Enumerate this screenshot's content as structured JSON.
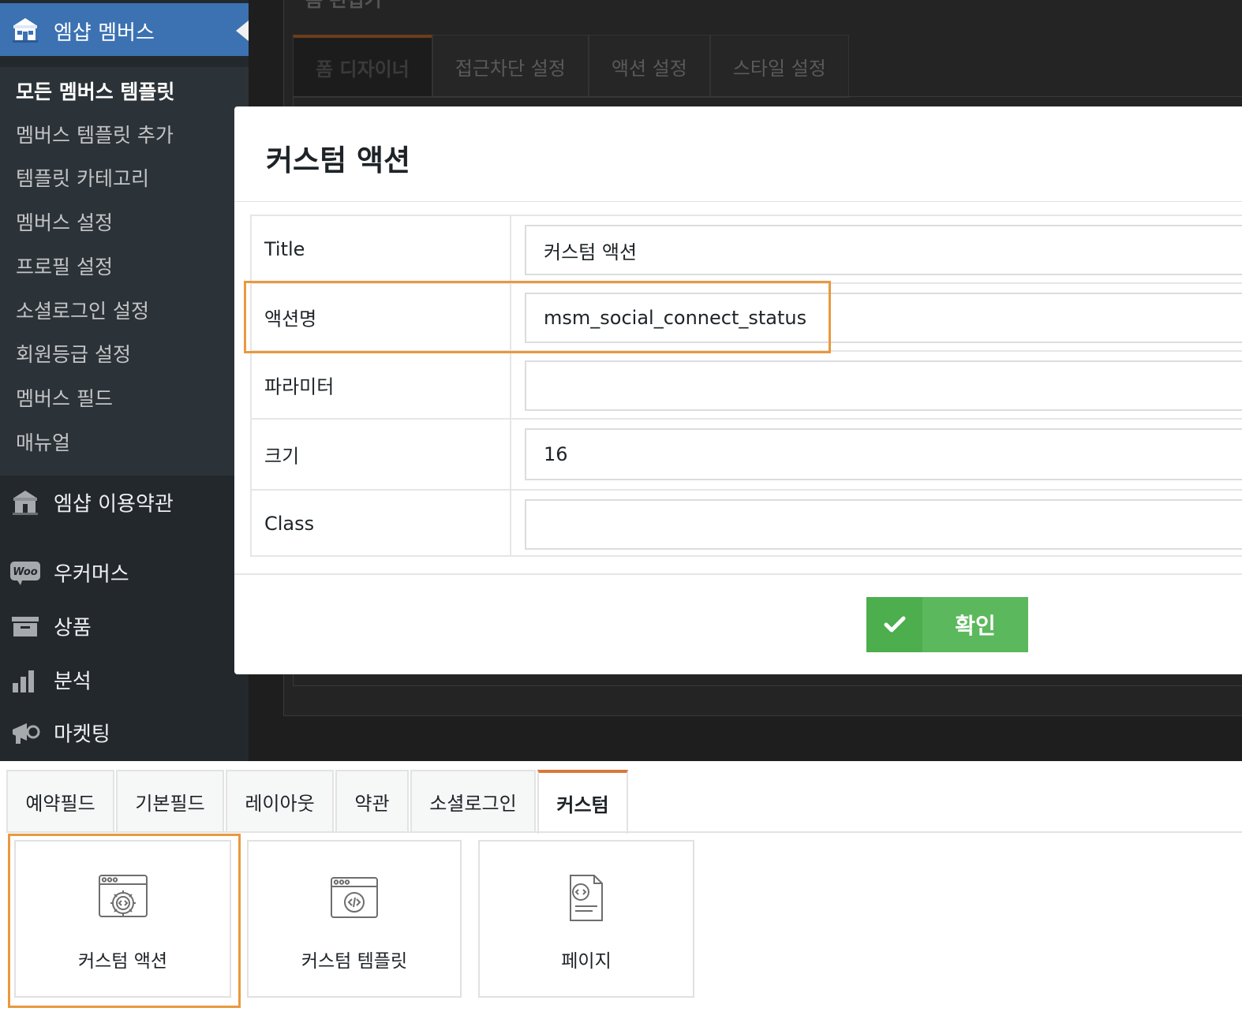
{
  "sidebar": {
    "plugin_menu": {
      "label": "엠샵 멤버스",
      "icon": "mshop-store-icon"
    },
    "submenu": [
      {
        "label": "모든 멤버스 템플릿",
        "active": true
      },
      {
        "label": "멤버스 템플릿 추가"
      },
      {
        "label": "템플릿 카테고리"
      },
      {
        "label": "멤버스 설정"
      },
      {
        "label": "프로필 설정"
      },
      {
        "label": "소셜로그인 설정"
      },
      {
        "label": "회원등급 설정"
      },
      {
        "label": "멤버스 필드"
      },
      {
        "label": "매뉴얼"
      }
    ],
    "menu_items": [
      {
        "label": "엠샵 이용약관",
        "icon": "mshop-store-icon"
      },
      {
        "label": "우커머스",
        "icon": "woo-icon",
        "icon_text": "Woo"
      },
      {
        "label": "상품",
        "icon": "archive-icon"
      },
      {
        "label": "분석",
        "icon": "bar-chart-icon"
      },
      {
        "label": "마켓팅",
        "icon": "megaphone-icon"
      }
    ],
    "colors": {
      "bg": "#23282d",
      "active": "#3c72b2"
    }
  },
  "background_editor": {
    "title": "폼 편집기",
    "tabs": [
      {
        "label": "폼 디자이너",
        "active": true
      },
      {
        "label": "접근차단 설정"
      },
      {
        "label": "액션 설정"
      },
      {
        "label": "스타일 설정"
      }
    ]
  },
  "modal": {
    "title": "커스텀 액션",
    "fields": [
      {
        "label": "Title",
        "value": "커스텀 액션"
      },
      {
        "label": "액션명",
        "value": "msm_social_connect_status",
        "highlighted": true
      },
      {
        "label": "파라미터",
        "value": ""
      },
      {
        "label": "크기",
        "value": "16"
      },
      {
        "label": "Class",
        "value": ""
      }
    ],
    "confirm_label": "확인",
    "confirm_color": "#5cb85c",
    "highlight_color": "#e9993e"
  },
  "palette": {
    "tabs": [
      {
        "label": "예약필드"
      },
      {
        "label": "기본필드"
      },
      {
        "label": "레이아웃"
      },
      {
        "label": "약관"
      },
      {
        "label": "소셜로그인"
      },
      {
        "label": "커스텀",
        "active": true
      }
    ],
    "items": [
      {
        "label": "커스텀 액션",
        "icon": "custom-action-gear-code-icon",
        "highlighted": true
      },
      {
        "label": "커스텀 템플릿",
        "icon": "custom-template-code-icon"
      },
      {
        "label": "페이지",
        "icon": "page-code-icon"
      }
    ],
    "active_tab_color": "#d9773a"
  }
}
